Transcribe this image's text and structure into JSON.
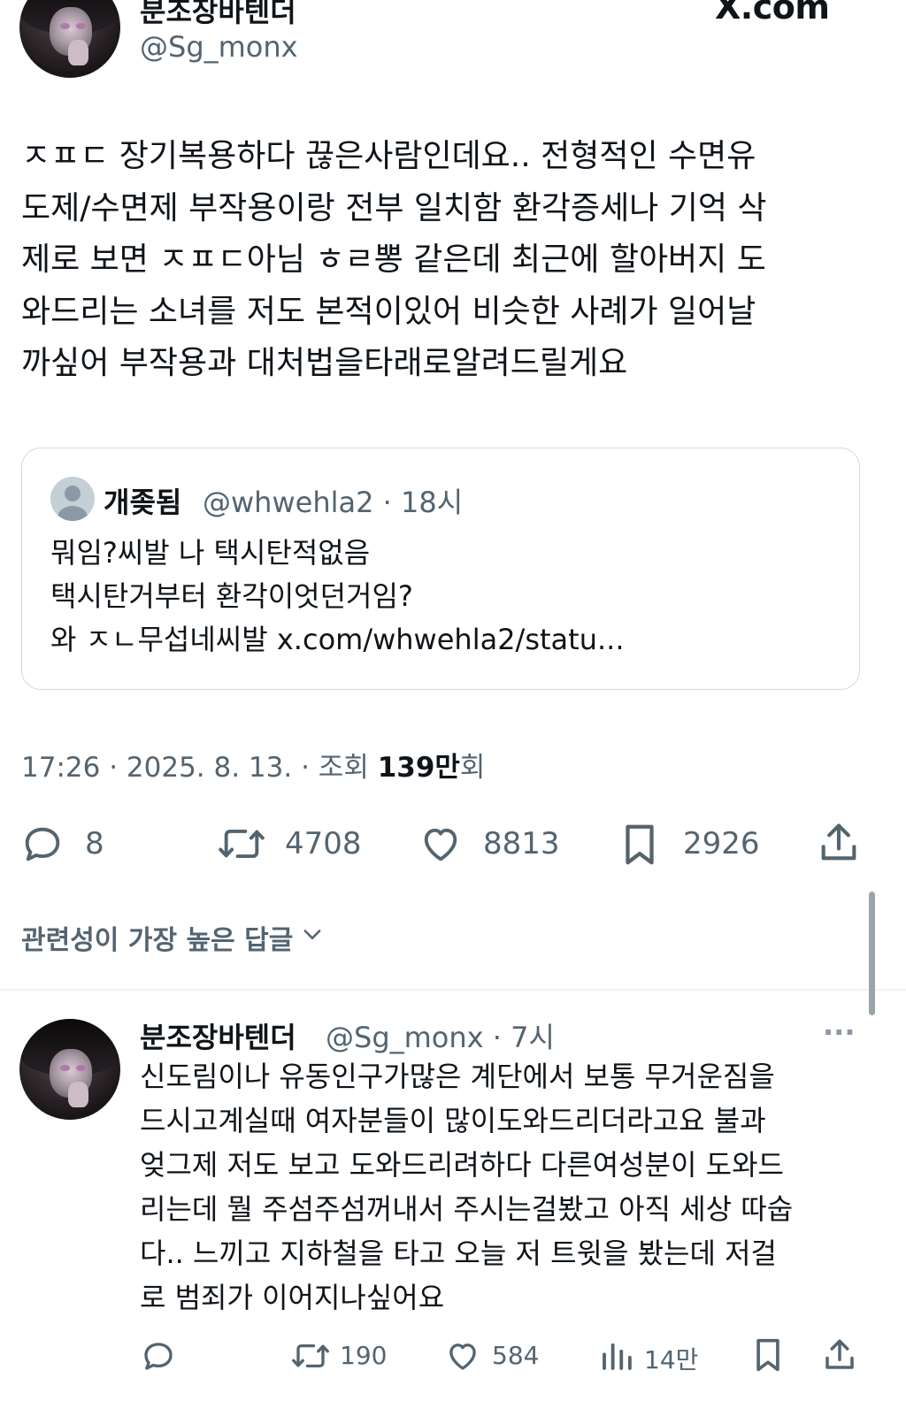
{
  "site_label": "X.com",
  "tweet": {
    "display_name": "분조장바텐더",
    "handle": "@Sg_monx",
    "lines": [
      "ㅈㅍㄷ 장기복용하다 끊은사람인데요.. 전형적인 수면유",
      "도제/수면제 부작용이랑 전부 일치함 환각증세나 기억 삭",
      "제로 보면 ㅈㅍㄷ아님 ㅎㄹ뽕 같은데 최근에 할아버지 도",
      "와드리는 소녀를 저도 본적이있어 비슷한 사례가 일어날",
      "까싶어 부작용과 대처법을타래로알려드릴게요"
    ],
    "quote": {
      "display_name": "개좆됨",
      "handle_time": "@whwehla2 · 18시",
      "lines": [
        "뭐임?씨발 나 택시탄적없음",
        "택시탄거부터 환각이엇던거임?",
        "와 ㅈㄴ무섭네씨발 x.com/whwehla2/statu..."
      ]
    },
    "meta_prefix": "17:26 · 2025. 8. 13. · 조회 ",
    "views_bold": "139만",
    "views_suffix": "회",
    "stats": {
      "replies": "8",
      "retweets": "4708",
      "likes": "8813",
      "bookmarks": "2926"
    }
  },
  "sort_label": "관련성이 가장 높은 답글",
  "reply": {
    "display_name": "분조장바텐더",
    "handle_time": "@Sg_monx · 7시",
    "more": "···",
    "lines": [
      "신도림이나 유동인구가많은 계단에서 보통 무거운짐을",
      "드시고계실때 여자분들이 많이도와드리더라고요 불과",
      "엊그제 저도 보고 도와드리려하다 다른여성분이 도와드",
      "리는데 뭘 주섬주섬꺼내서 주시는걸봤고 아직 세상 따숩",
      "다.. 느끼고 지하철을 타고 오늘 저 트윗을 봤는데 저걸",
      "로 범죄가 이어지나싶어요"
    ],
    "stats": {
      "retweets": "190",
      "likes": "584",
      "views": "14만"
    }
  },
  "icons": {
    "reply": "speech-bubble-icon",
    "retweet": "retweet-icon",
    "like": "heart-icon",
    "bookmark": "bookmark-icon",
    "share": "share-icon",
    "views": "bar-chart-icon",
    "chevron": "chevron-down-icon",
    "default_avatar": "default-avatar-icon"
  },
  "colors": {
    "text": "#0f1419",
    "secondary": "#536471",
    "border": "#cfd9de"
  }
}
